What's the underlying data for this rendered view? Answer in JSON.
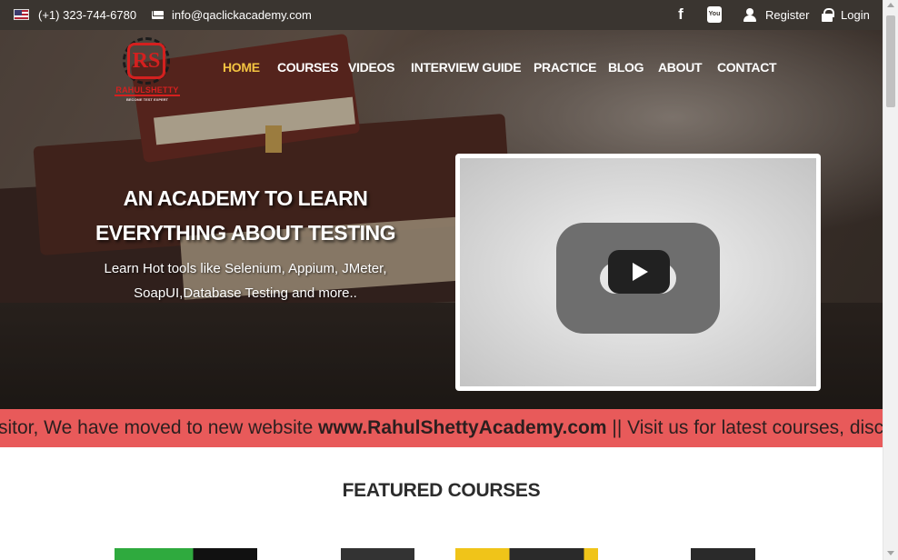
{
  "topbar": {
    "phone": "(+1) 323-744-6780",
    "email": "info@qaclickacademy.com",
    "register_label": "Register",
    "login_label": "Login",
    "youtube_icon_text": "You Tube",
    "icons": [
      "us-flag-icon",
      "mail-icon",
      "facebook-icon",
      "youtube-icon",
      "user-icon",
      "lock-icon"
    ]
  },
  "logo": {
    "monogram": "RS",
    "name": "RAHULSHETTY",
    "tagline": "BECOME TEST EXPERT"
  },
  "nav": {
    "items": [
      {
        "label": "HOME",
        "active": true
      },
      {
        "label": "COURSES",
        "active": false
      },
      {
        "label": "VIDEOS",
        "active": false
      },
      {
        "label": "INTERVIEW GUIDE",
        "active": false
      },
      {
        "label": "PRACTICE",
        "active": false
      },
      {
        "label": "BLOG",
        "active": false
      },
      {
        "label": "ABOUT",
        "active": false
      },
      {
        "label": "CONTACT",
        "active": false
      }
    ],
    "active_color": "#f3c341"
  },
  "hero": {
    "title_line1": "AN ACADEMY TO LEARN",
    "title_line2": "EVERYTHING ABOUT TESTING",
    "subtitle_line1": "Learn Hot tools like Selenium, Appium, JMeter,",
    "subtitle_line2": "SoapUI,Database Testing and more.."
  },
  "marquee": {
    "text_before": "sitor, We have moved to new website ",
    "link_text": "www.RahulShettyAcademy.com",
    "text_after": " || Visit us for latest courses, discount cou",
    "background": "#e85a5a"
  },
  "featured": {
    "title": "FEATURED COURSES"
  }
}
